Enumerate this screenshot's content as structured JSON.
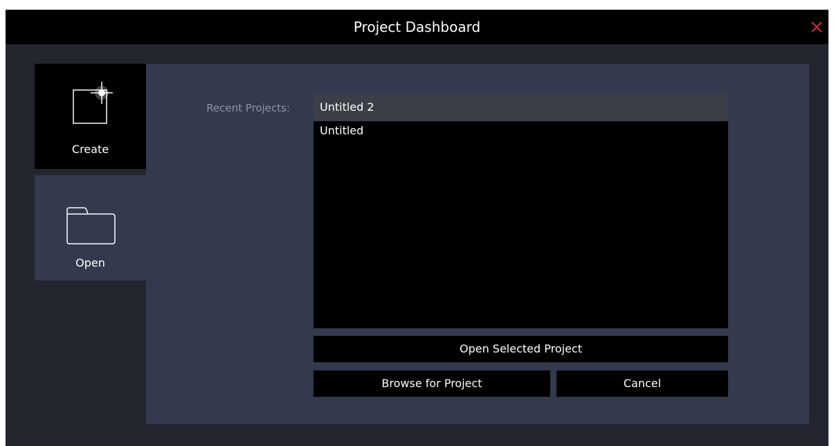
{
  "window": {
    "title": "Project Dashboard",
    "close_icon": "close-icon",
    "accent_close": "#d32f2f"
  },
  "tabs": [
    {
      "label": "Create",
      "icon": "new-project-sparkle-icon",
      "active": false
    },
    {
      "label": "Open",
      "icon": "folder-icon",
      "active": true
    }
  ],
  "open_panel": {
    "recent_label": "Recent Projects:",
    "recent_projects": [
      {
        "name": "Untitled 2",
        "selected": true
      },
      {
        "name": "Untitled",
        "selected": false
      }
    ],
    "open_selected_label": "Open Selected Project",
    "browse_label": "Browse for Project",
    "cancel_label": "Cancel"
  }
}
